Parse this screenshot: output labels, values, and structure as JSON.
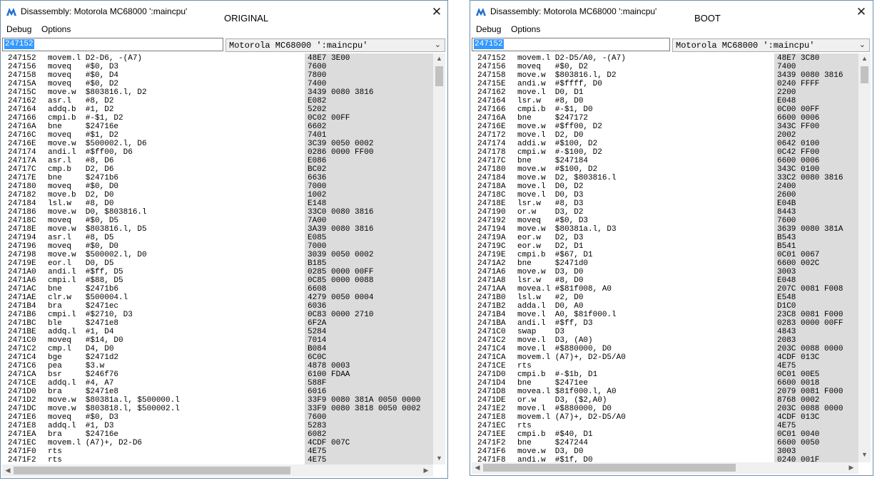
{
  "colors": {
    "selection": "#3399ff",
    "bytes_column": "#dcdcdc",
    "icon": "#1e6fcf"
  },
  "icons": {
    "app": "mame-logo-icon",
    "close": "close-icon",
    "dropdown": "chevron-down-icon"
  },
  "left": {
    "title": "Disassembly: Motorola MC68000 ':maincpu'",
    "tag": "ORIGINAL",
    "close": "✕",
    "menu": {
      "debug": "Debug",
      "options": "Options"
    },
    "address": "247152",
    "cpu": "Motorola MC68000 ':maincpu'",
    "lines": [
      [
        "247152",
        "movem.l D2-D6, -(A7)",
        "48E7 3E00"
      ],
      [
        "247156",
        "moveq   #$0, D3",
        "7600"
      ],
      [
        "247158",
        "moveq   #$0, D4",
        "7800"
      ],
      [
        "24715A",
        "moveq   #$0, D2",
        "7400"
      ],
      [
        "24715C",
        "move.w  $803816.l, D2",
        "3439 0080 3816"
      ],
      [
        "247162",
        "asr.l   #8, D2",
        "E082"
      ],
      [
        "247164",
        "addq.b  #1, D2",
        "5202"
      ],
      [
        "247166",
        "cmpi.b  #-$1, D2",
        "0C02 00FF"
      ],
      [
        "24716A",
        "bne     $24716e",
        "6602"
      ],
      [
        "24716C",
        "moveq   #$1, D2",
        "7401"
      ],
      [
        "24716E",
        "move.w  $500002.l, D6",
        "3C39 0050 0002"
      ],
      [
        "247174",
        "andi.l  #$ff00, D6",
        "0286 0000 FF00"
      ],
      [
        "24717A",
        "asr.l   #8, D6",
        "E086"
      ],
      [
        "24717C",
        "cmp.b   D2, D6",
        "BC02"
      ],
      [
        "24717E",
        "bne     $2471b6",
        "6636"
      ],
      [
        "247180",
        "moveq   #$0, D0",
        "7000"
      ],
      [
        "247182",
        "move.b  D2, D0",
        "1002"
      ],
      [
        "247184",
        "lsl.w   #8, D0",
        "E148"
      ],
      [
        "247186",
        "move.w  D0, $803816.l",
        "33C0 0080 3816"
      ],
      [
        "24718C",
        "moveq   #$0, D5",
        "7A00"
      ],
      [
        "24718E",
        "move.w  $803816.l, D5",
        "3A39 0080 3816"
      ],
      [
        "247194",
        "asr.l   #8, D5",
        "E085"
      ],
      [
        "247196",
        "moveq   #$0, D0",
        "7000"
      ],
      [
        "247198",
        "move.w  $500002.l, D0",
        "3039 0050 0002"
      ],
      [
        "24719E",
        "eor.l   D0, D5",
        "B185"
      ],
      [
        "2471A0",
        "andi.l  #$ff, D5",
        "0285 0000 00FF"
      ],
      [
        "2471A6",
        "cmpi.l  #$88, D5",
        "0C85 0000 0088"
      ],
      [
        "2471AC",
        "bne     $2471b6",
        "6608"
      ],
      [
        "2471AE",
        "clr.w   $500004.l",
        "4279 0050 0004"
      ],
      [
        "2471B4",
        "bra     $2471ec",
        "6036"
      ],
      [
        "2471B6",
        "cmpi.l  #$2710, D3",
        "0C83 0000 2710"
      ],
      [
        "2471BC",
        "ble     $2471e8",
        "6F2A"
      ],
      [
        "2471BE",
        "addq.l  #1, D4",
        "5284"
      ],
      [
        "2471C0",
        "moveq   #$14, D0",
        "7014"
      ],
      [
        "2471C2",
        "cmp.l   D4, D0",
        "B084"
      ],
      [
        "2471C4",
        "bge     $2471d2",
        "6C0C"
      ],
      [
        "2471C6",
        "pea     $3.w",
        "4878 0003"
      ],
      [
        "2471CA",
        "bsr     $246f76",
        "6100 FDAA"
      ],
      [
        "2471CE",
        "addq.l  #4, A7",
        "588F"
      ],
      [
        "2471D0",
        "bra     $2471e8",
        "6016"
      ],
      [
        "2471D2",
        "move.w  $80381a.l, $500000.l",
        "33F9 0080 381A 0050 0000"
      ],
      [
        "2471DC",
        "move.w  $803818.l, $500002.l",
        "33F9 0080 3818 0050 0002"
      ],
      [
        "2471E6",
        "moveq   #$0, D3",
        "7600"
      ],
      [
        "2471E8",
        "addq.l  #1, D3",
        "5283"
      ],
      [
        "2471EA",
        "bra     $24716e",
        "6082"
      ],
      [
        "2471EC",
        "movem.l (A7)+, D2-D6",
        "4CDF 007C"
      ],
      [
        "2471F0",
        "rts",
        "4E75"
      ],
      [
        "2471F2",
        "rts",
        "4E75"
      ]
    ]
  },
  "right": {
    "title": "Disassembly: Motorola MC68000 ':maincpu'",
    "tag": "BOOT",
    "close": "✕",
    "menu": {
      "debug": "Debug",
      "options": "Options"
    },
    "address": "247152",
    "cpu": "Motorola MC68000 ':maincpu'",
    "lines": [
      [
        "247152",
        "movem.l D2-D5/A0, -(A7)",
        "48E7 3C80"
      ],
      [
        "247156",
        "moveq   #$0, D2",
        "7400"
      ],
      [
        "247158",
        "move.w  $803816.l, D2",
        "3439 0080 3816"
      ],
      [
        "24715E",
        "andi.w  #$ffff, D0",
        "0240 FFFF"
      ],
      [
        "247162",
        "move.l  D0, D1",
        "2200"
      ],
      [
        "247164",
        "lsr.w   #8, D0",
        "E048"
      ],
      [
        "247166",
        "cmpi.b  #-$1, D0",
        "0C00 00FF"
      ],
      [
        "24716A",
        "bne     $247172",
        "6600 0006"
      ],
      [
        "24716E",
        "move.w  #$ff00, D2",
        "343C FF00"
      ],
      [
        "247172",
        "move.l  D2, D0",
        "2002"
      ],
      [
        "247174",
        "addi.w  #$100, D2",
        "0642 0100"
      ],
      [
        "247178",
        "cmpi.w  #-$100, D2",
        "0C42 FF00"
      ],
      [
        "24717C",
        "bne     $247184",
        "6600 0006"
      ],
      [
        "247180",
        "move.w  #$100, D2",
        "343C 0100"
      ],
      [
        "247184",
        "move.w  D2, $803816.l",
        "33C2 0080 3816"
      ],
      [
        "24718A",
        "move.l  D0, D2",
        "2400"
      ],
      [
        "24718C",
        "move.l  D0, D3",
        "2600"
      ],
      [
        "24718E",
        "lsr.w   #8, D3",
        "E04B"
      ],
      [
        "247190",
        "or.w    D3, D2",
        "8443"
      ],
      [
        "247192",
        "moveq   #$0, D3",
        "7600"
      ],
      [
        "247194",
        "move.w  $80381a.l, D3",
        "3639 0080 381A"
      ],
      [
        "24719A",
        "eor.w   D2, D3",
        "B543"
      ],
      [
        "24719C",
        "eor.w   D2, D1",
        "B541"
      ],
      [
        "24719E",
        "cmpi.b  #$67, D1",
        "0C01 0067"
      ],
      [
        "2471A2",
        "bne     $2471d0",
        "6600 002C"
      ],
      [
        "2471A6",
        "move.w  D3, D0",
        "3003"
      ],
      [
        "2471A8",
        "lsr.w   #8, D0",
        "E048"
      ],
      [
        "2471AA",
        "movea.l #$81f008, A0",
        "207C 0081 F008"
      ],
      [
        "2471B0",
        "lsl.w   #2, D0",
        "E548"
      ],
      [
        "2471B2",
        "adda.l  D0, A0",
        "D1C0"
      ],
      [
        "2471B4",
        "move.l  A0, $81f000.l",
        "23C8 0081 F000"
      ],
      [
        "2471BA",
        "andi.l  #$ff, D3",
        "0283 0000 00FF"
      ],
      [
        "2471C0",
        "swap    D3",
        "4843"
      ],
      [
        "2471C2",
        "move.l  D3, (A0)",
        "2083"
      ],
      [
        "2471C4",
        "move.l  #$880000, D0",
        "203C 0088 0000"
      ],
      [
        "2471CA",
        "movem.l (A7)+, D2-D5/A0",
        "4CDF 013C"
      ],
      [
        "2471CE",
        "rts",
        "4E75"
      ],
      [
        "2471D0",
        "cmpi.b  #-$1b, D1",
        "0C01 00E5"
      ],
      [
        "2471D4",
        "bne     $2471ee",
        "6600 0018"
      ],
      [
        "2471D8",
        "movea.l $81f000.l, A0",
        "2079 0081 F000"
      ],
      [
        "2471DE",
        "or.w    D3, ($2,A0)",
        "8768 0002"
      ],
      [
        "2471E2",
        "move.l  #$880000, D0",
        "203C 0088 0000"
      ],
      [
        "2471E8",
        "movem.l (A7)+, D2-D5/A0",
        "4CDF 013C"
      ],
      [
        "2471EC",
        "rts",
        "4E75"
      ],
      [
        "2471EE",
        "cmpi.b  #$40, D1",
        "0C01 0040"
      ],
      [
        "2471F2",
        "bne     $247244",
        "6600 0050"
      ],
      [
        "2471F6",
        "move.w  D3, D0",
        "3003"
      ],
      [
        "2471F8",
        "andi.w  #$1f, D0",
        "0240 001F"
      ]
    ]
  }
}
